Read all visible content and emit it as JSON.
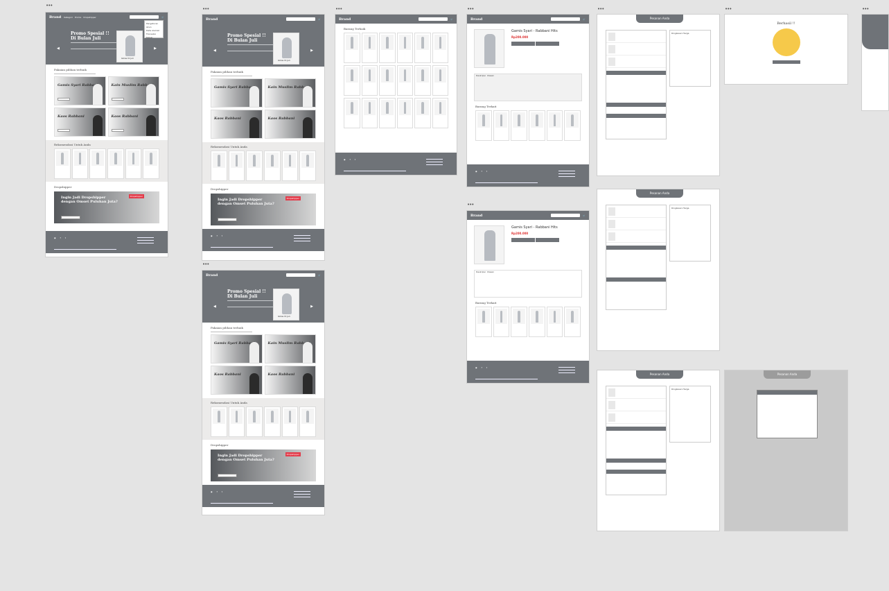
{
  "frame_label": "•••",
  "nav": {
    "brand": "Brand",
    "menu": [
      "Kategori",
      "Promo",
      "Dropshipper"
    ],
    "icons": [
      "cart-icon",
      "user-icon"
    ]
  },
  "hero": {
    "title_line1": "Promo Spesial !!",
    "title_line2": "Di Bulan Juli",
    "caption": "Gikas Di Juli"
  },
  "sections": {
    "pilihan": "Pakaian pilihan terbaik",
    "rekomendasi": "Rekomendasi Untuk Anda",
    "dropshipper": "Dropshipper"
  },
  "cards": [
    "Gamis Syari Rabbani",
    "Kain Muslim Rabbani",
    "Kaos Rabbani",
    "Kaos Rabbani"
  ],
  "banner": {
    "line1": "Ingin Jadi Dropshipper",
    "line2": "dengan Omset Puluhan Juta?",
    "tag": "Dropshipper"
  },
  "listing": {
    "title": "Barang Terbaik"
  },
  "detail": {
    "title": "Gamis Syari - Rabbani Hits",
    "price": "Rp200.000",
    "tabs": [
      "Deskripsi",
      "Ulasan"
    ],
    "related": "Barang Terkait"
  },
  "cart": {
    "title": "Pesanan Anda",
    "ringkasan": "Ringkasan Harga"
  },
  "success": {
    "title": "Berhasil !!"
  },
  "dropdown": [
    "Pengaturan Akun",
    "Data Alamat",
    "Transaksi",
    "Keluar"
  ]
}
